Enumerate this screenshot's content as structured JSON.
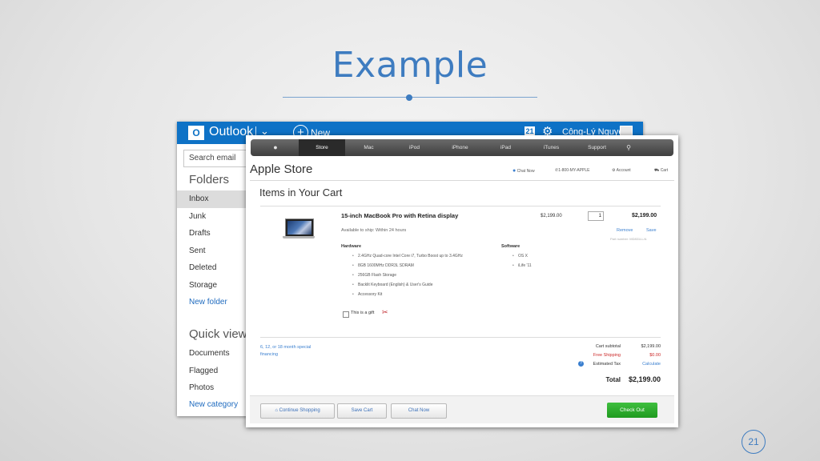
{
  "slide": {
    "title": "Example",
    "page_number": "21"
  },
  "outlook": {
    "logo_letter": "O",
    "brand": "Outlook",
    "new_label": "New",
    "calendar_number": "21",
    "user_name": "Công-Lý Nguyễn",
    "search_placeholder": "Search email",
    "folders_heading": "Folders",
    "folders": [
      "Inbox",
      "Junk",
      "Drafts",
      "Sent",
      "Deleted",
      "Storage"
    ],
    "new_folder": "New folder",
    "quick_views_heading": "Quick views",
    "quick_views": [
      "Documents",
      "Flagged",
      "Photos"
    ],
    "new_category": "New category",
    "accent_color": "#0e72c6"
  },
  "store": {
    "nav": [
      "Store",
      "Mac",
      "iPod",
      "iPhone",
      "iPad",
      "iTunes",
      "Support"
    ],
    "active_nav": "Store",
    "heading": "Apple Store",
    "header_links": {
      "chat": "Chat Now",
      "phone": "1-800-MY-APPLE",
      "account": "Account",
      "cart": "Cart"
    },
    "cart_heading": "Items in Your Cart",
    "product": {
      "title": "15-inch MacBook Pro with Retina display",
      "unit_price": "$2,199.00",
      "quantity": "1",
      "line_total": "$2,199.00",
      "availability": "Available to ship: Within 24 hours",
      "remove": "Remove",
      "save": "Save",
      "part_number": "Part number: MD831LL/A",
      "hardware_heading": "Hardware",
      "hardware": [
        "2.4GHz Quad-core Intel Core i7, Turbo Boost up to 3.4GHz",
        "8GB 1600MHz DDR3L SDRAM",
        "256GB Flash Storage",
        "Backlit Keyboard (English) & User's Guide",
        "Accessory Kit"
      ],
      "software_heading": "Software",
      "software": [
        "OS X",
        "iLife '11"
      ],
      "gift_label": "This is a gift"
    },
    "financing": "6, 12, or 18 month special financing",
    "summary": {
      "subtotal_label": "Cart subtotal",
      "subtotal": "$2,199.00",
      "shipping_label": "Free Shipping",
      "shipping": "$0.00",
      "tax_label": "Estimated Tax",
      "tax": "Calculate",
      "total_label": "Total",
      "total": "$2,199.00"
    },
    "buttons": {
      "continue": "Continue Shopping",
      "save_cart": "Save Cart",
      "chat_now": "Chat Now",
      "checkout": "Check Out"
    },
    "checkout_color": "#2aa82a"
  }
}
